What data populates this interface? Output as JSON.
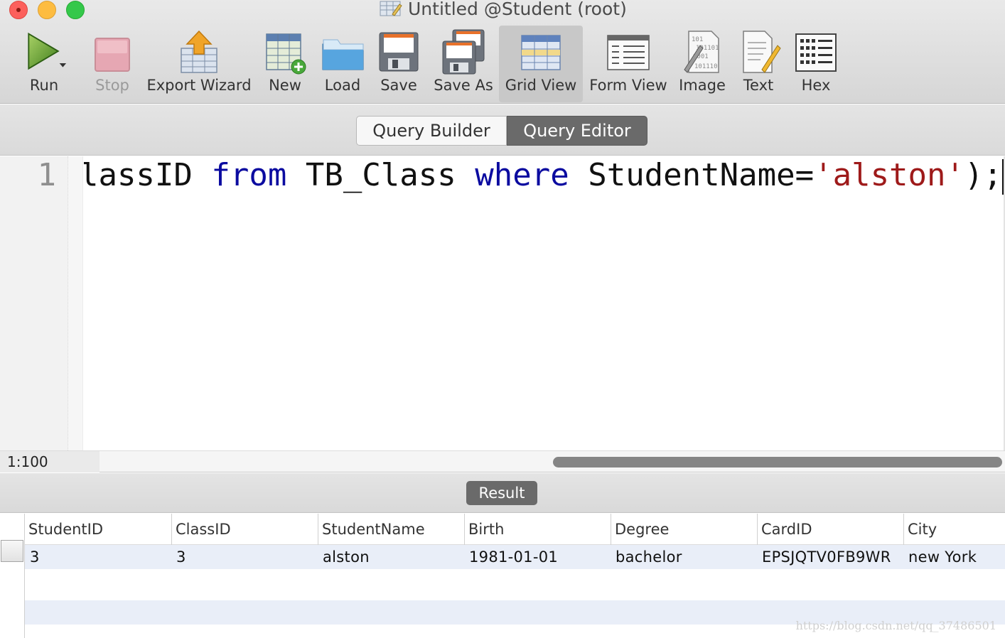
{
  "window": {
    "title": "Untitled @Student (root)"
  },
  "toolbar": {
    "run": "Run",
    "stop": "Stop",
    "export_wizard": "Export Wizard",
    "new": "New",
    "load": "Load",
    "save": "Save",
    "save_as": "Save As",
    "grid_view": "Grid View",
    "form_view": "Form View",
    "image": "Image",
    "text": "Text",
    "hex": "Hex"
  },
  "tabs": {
    "query_builder": "Query Builder",
    "query_editor": "Query Editor",
    "active": "Query Editor"
  },
  "editor": {
    "line_number": "1",
    "tokens": [
      {
        "text": "ClassID ",
        "kind": "plain"
      },
      {
        "text": "from",
        "kind": "kw"
      },
      {
        "text": " TB_Class ",
        "kind": "plain"
      },
      {
        "text": "where",
        "kind": "kw"
      },
      {
        "text": " StudentName=",
        "kind": "plain"
      },
      {
        "text": "'alston'",
        "kind": "str"
      },
      {
        "text": ");",
        "kind": "plain"
      }
    ],
    "cursor_position": "1:100"
  },
  "result": {
    "tab_label": "Result",
    "columns": [
      "StudentID",
      "ClassID",
      "StudentName",
      "Birth",
      "Degree",
      "CardID",
      "City"
    ],
    "rows": [
      [
        "3",
        "3",
        "alston",
        "1981-01-01",
        "bachelor",
        "EPSJQTV0FB9WR",
        "new York"
      ]
    ]
  },
  "watermark": "https://blog.csdn.net/qq_37486501",
  "colors": {
    "keyword": "#0b0ba0",
    "string": "#9e1a1a",
    "selected_tab": "#6a6a6a",
    "row_highlight": "#e9eef8"
  }
}
